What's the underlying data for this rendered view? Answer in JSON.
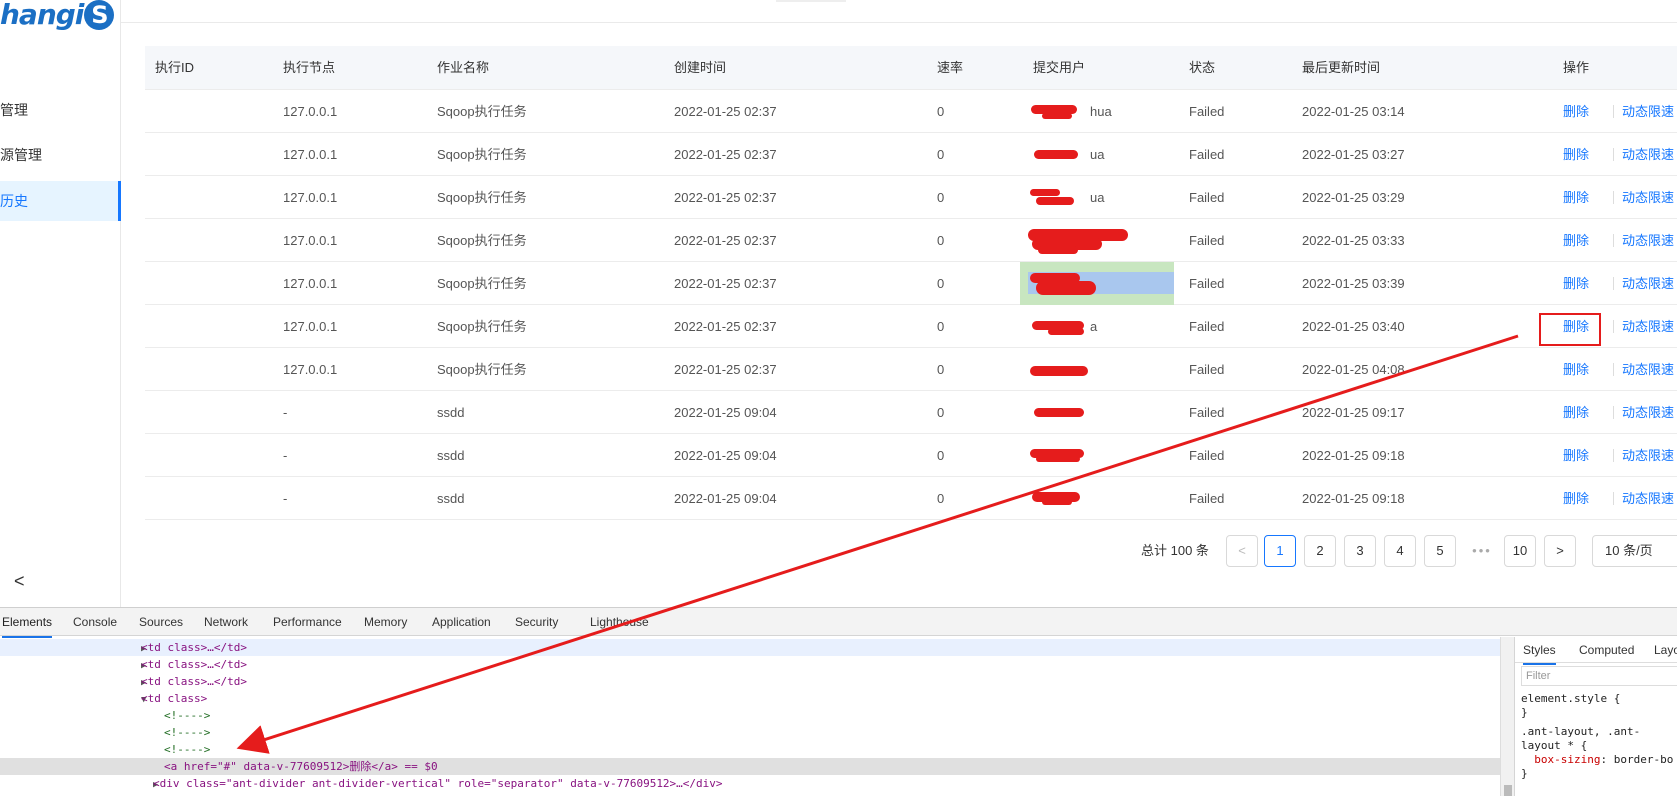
{
  "app": {
    "logo_text": "hangi",
    "logo_badge": "S",
    "nav": [
      {
        "label": "管理"
      },
      {
        "label": "源管理"
      },
      {
        "label": "历史"
      }
    ],
    "collapse_glyph": "<"
  },
  "table": {
    "headers": [
      "执行ID",
      "执行节点",
      "作业名称",
      "创建时间",
      "速率",
      "提交用户",
      "状态",
      "最后更新时间",
      "操作"
    ],
    "rows": [
      {
        "node": "127.0.0.1",
        "job": "Sqoop执行任务",
        "created": "2022-01-25 02:37",
        "rate": "0",
        "user_tail": "hua",
        "status": "Failed",
        "updated": "2022-01-25 03:14"
      },
      {
        "node": "127.0.0.1",
        "job": "Sqoop执行任务",
        "created": "2022-01-25 02:37",
        "rate": "0",
        "user_tail": "ua",
        "status": "Failed",
        "updated": "2022-01-25 03:27"
      },
      {
        "node": "127.0.0.1",
        "job": "Sqoop执行任务",
        "created": "2022-01-25 02:37",
        "rate": "0",
        "user_tail": "ua",
        "status": "Failed",
        "updated": "2022-01-25 03:29"
      },
      {
        "node": "127.0.0.1",
        "job": "Sqoop执行任务",
        "created": "2022-01-25 02:37",
        "rate": "0",
        "user_tail": "",
        "status": "Failed",
        "updated": "2022-01-25 03:33"
      },
      {
        "node": "127.0.0.1",
        "job": "Sqoop执行任务",
        "created": "2022-01-25 02:37",
        "rate": "0",
        "user_tail": "",
        "status": "Failed",
        "updated": "2022-01-25 03:39"
      },
      {
        "node": "127.0.0.1",
        "job": "Sqoop执行任务",
        "created": "2022-01-25 02:37",
        "rate": "0",
        "user_tail": "a",
        "status": "Failed",
        "updated": "2022-01-25 03:40"
      },
      {
        "node": "127.0.0.1",
        "job": "Sqoop执行任务",
        "created": "2022-01-25 02:37",
        "rate": "0",
        "user_tail": "",
        "status": "Failed",
        "updated": "2022-01-25 04:08"
      },
      {
        "node": "-",
        "job": "ssdd",
        "created": "2022-01-25 09:04",
        "rate": "0",
        "user_tail": "",
        "status": "Failed",
        "updated": "2022-01-25 09:17"
      },
      {
        "node": "-",
        "job": "ssdd",
        "created": "2022-01-25 09:04",
        "rate": "0",
        "user_tail": "",
        "status": "Failed",
        "updated": "2022-01-25 09:18"
      },
      {
        "node": "-",
        "job": "ssdd",
        "created": "2022-01-25 09:04",
        "rate": "0",
        "user_tail": "",
        "status": "Failed",
        "updated": "2022-01-25 09:18"
      }
    ],
    "action_delete": "删除",
    "action_throttle": "动态限速"
  },
  "pagination": {
    "total": "总计 100 条",
    "prev": "<",
    "pages": [
      "1",
      "2",
      "3",
      "4",
      "5"
    ],
    "ellipsis": "•••",
    "last": "10",
    "next": ">",
    "page_size": "10 条/页",
    "current": "1"
  },
  "devtools": {
    "tabs": [
      "Elements",
      "Console",
      "Sources",
      "Network",
      "Performance",
      "Memory",
      "Application",
      "Security",
      "Lighthouse"
    ],
    "active_tab": "Elements",
    "dom_lines": [
      {
        "indent": "td_collapsed",
        "text": "<td class>…</td>"
      },
      {
        "indent": "td_collapsed",
        "text": "<td class>…</td>"
      },
      {
        "indent": "td_collapsed",
        "text": "<td class>…</td>"
      },
      {
        "indent": "td_open",
        "text": "<td class>"
      },
      {
        "indent": "comment",
        "text": "<!---->"
      },
      {
        "indent": "comment",
        "text": "<!---->"
      },
      {
        "indent": "comment",
        "text": "<!---->"
      },
      {
        "indent": "anchor",
        "text": "<a href=\"#\" data-v-77609512>删除</a> == $0"
      },
      {
        "indent": "divider",
        "text": "<div class=\"ant-divider ant-divider-vertical\" role=\"separator\" data-v-77609512>…</div>"
      }
    ],
    "styles_tabs": [
      "Styles",
      "Computed",
      "Layo"
    ],
    "filter_placeholder": "Filter",
    "css_rules": [
      {
        "selector": "element.style {",
        "close": "}"
      },
      {
        "selector": ".ant-layout, .ant-",
        "selector2": "layout * {",
        "prop": "box-sizing",
        "value": "border-bo",
        "close": "}"
      }
    ]
  },
  "colors": {
    "link": "#1677ff",
    "annotation_red": "#e51c1c",
    "header_bg": "#f5f7fa"
  }
}
